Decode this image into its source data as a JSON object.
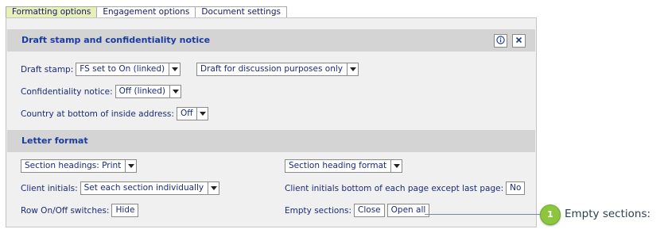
{
  "tabs": [
    {
      "label": "Formatting options",
      "active": true
    },
    {
      "label": "Engagement options",
      "active": false
    },
    {
      "label": "Document settings",
      "active": false
    }
  ],
  "draft_section": {
    "title": "Draft stamp and confidentiality notice",
    "info_icon": "info-icon",
    "close_icon": "close-icon",
    "draft_stamp_label": "Draft stamp:",
    "draft_stamp_value": "FS set to On (linked)",
    "draft_text_value": "Draft for discussion purposes only",
    "confidentiality_label": "Confidentiality notice:",
    "confidentiality_value": "Off (linked)",
    "country_label": "Country at bottom of inside address:",
    "country_value": "Off"
  },
  "letter_section": {
    "title": "Letter format",
    "section_headings_value": "Section headings: Print",
    "section_heading_format_value": "Section heading format",
    "client_initials_label": "Client initials:",
    "client_initials_value": "Set each section individually",
    "client_initials_bottom_label": "Client initials bottom of each page except last page:",
    "client_initials_bottom_value": "No",
    "row_switches_label": "Row On/Off switches:",
    "row_switches_value": "Hide",
    "empty_sections_label": "Empty sections:",
    "close_label": "Close",
    "open_all_label": "Open all"
  },
  "callout": {
    "number": "1",
    "text": "Empty sections:",
    "badge_color": "#8cc63f"
  },
  "colors": {
    "active_tab": "#e6f0b8",
    "section_header": "#d4d4d4",
    "panel_bg": "#f0f0f0",
    "title_blue": "#1a3ca0"
  }
}
